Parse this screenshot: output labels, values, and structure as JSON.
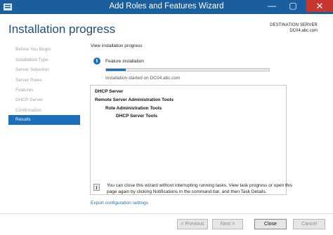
{
  "window": {
    "title": "Add Roles and Features Wizard",
    "minimize_glyph": "—",
    "maximize_glyph": "▢",
    "close_glyph": "✕",
    "app_icon": "server-manager-icon"
  },
  "header": {
    "title": "Installation progress",
    "destination_label": "DESTINATION SERVER",
    "destination_value": "DC04.abc.com"
  },
  "nav": {
    "items": [
      {
        "label": "Before You Begin"
      },
      {
        "label": "Installation Type"
      },
      {
        "label": "Server Selection"
      },
      {
        "label": "Server Roles"
      },
      {
        "label": "Features"
      },
      {
        "label": "DHCP Server"
      },
      {
        "label": "Confirmation"
      },
      {
        "label": "Results",
        "selected": true
      }
    ]
  },
  "content": {
    "view_label": "View installation progress",
    "feature_label": "Feature installation",
    "progress_fraction": 0.12,
    "started_label": "Installation started on DC04.abc.com",
    "results": [
      {
        "label": "DHCP Server",
        "level": 0
      },
      {
        "label": "Remote Server Administration Tools",
        "level": 0
      },
      {
        "label": "Role Administration Tools",
        "level": 1
      },
      {
        "label": "DHCP Server Tools",
        "level": 2
      }
    ],
    "note_line1": "You can close this wizard without interrupting running tasks. View task progress or open this",
    "note_line2": "page again by clicking Notifications in the command bar, and then Task Details.",
    "export_link": "Export configuration settings"
  },
  "footer": {
    "previous_label": "< Previous",
    "next_label": "Next >",
    "close_label": "Close",
    "cancel_label": "Cancel"
  },
  "colors": {
    "titlebar": "#1b5e9e",
    "accent": "#1b6fb8",
    "close_button": "#c7372f",
    "link": "#1e6fbd"
  }
}
